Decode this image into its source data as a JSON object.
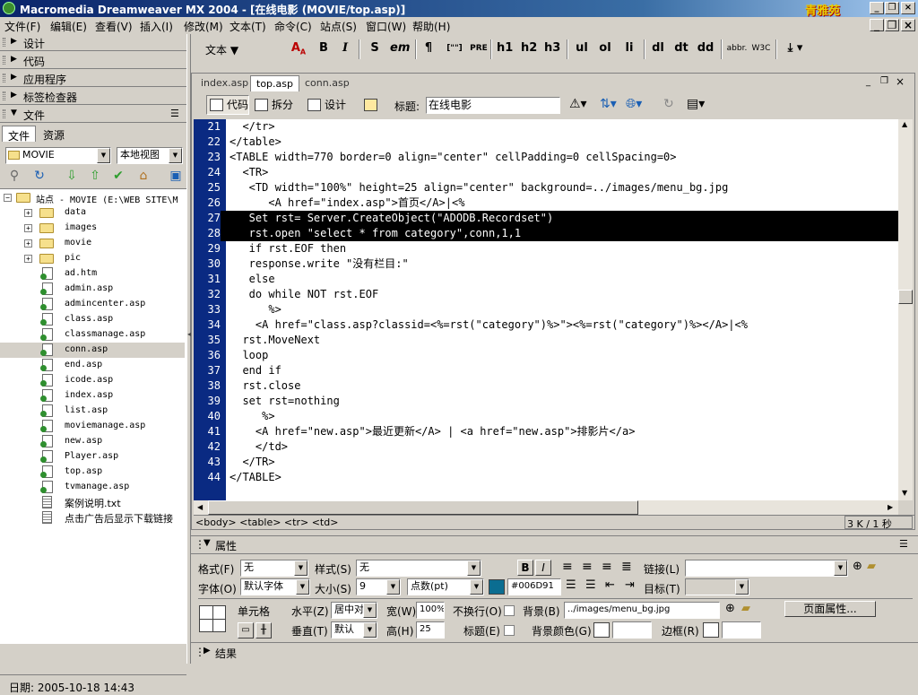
{
  "titlebar": {
    "text": "Macromedia Dreamweaver MX 2004 - [在线电影 (MOVIE/top.asp)]",
    "logo": "青雅苑"
  },
  "menus": [
    "文件(F)",
    "编辑(E)",
    "查看(V)",
    "插入(I)",
    "修改(M)",
    "文本(T)",
    "命令(C)",
    "站点(S)",
    "窗口(W)",
    "帮助(H)"
  ],
  "panels": [
    {
      "label": "设计",
      "collapsed": true
    },
    {
      "label": "代码",
      "collapsed": true
    },
    {
      "label": "应用程序",
      "collapsed": true
    },
    {
      "label": "标签检查器",
      "collapsed": true
    },
    {
      "label": "文件",
      "collapsed": false
    }
  ],
  "files_panel": {
    "tabs": [
      "文件",
      "资源"
    ],
    "site_select": "MOVIE",
    "view_select": "本地视图",
    "root": "站点 - MOVIE (E:\\WEB SITE\\M",
    "items": [
      {
        "name": "data",
        "type": "folder"
      },
      {
        "name": "images",
        "type": "folder"
      },
      {
        "name": "movie",
        "type": "folder"
      },
      {
        "name": "pic",
        "type": "folder"
      },
      {
        "name": "ad.htm",
        "type": "file"
      },
      {
        "name": "admin.asp",
        "type": "file"
      },
      {
        "name": "admincenter.asp",
        "type": "file"
      },
      {
        "name": "class.asp",
        "type": "file"
      },
      {
        "name": "classmanage.asp",
        "type": "file"
      },
      {
        "name": "conn.asp",
        "type": "file",
        "selected": true
      },
      {
        "name": "end.asp",
        "type": "file"
      },
      {
        "name": "icode.asp",
        "type": "file"
      },
      {
        "name": "index.asp",
        "type": "file"
      },
      {
        "name": "list.asp",
        "type": "file"
      },
      {
        "name": "moviemanage.asp",
        "type": "file"
      },
      {
        "name": "new.asp",
        "type": "file"
      },
      {
        "name": "Player.asp",
        "type": "file"
      },
      {
        "name": "top.asp",
        "type": "file"
      },
      {
        "name": "tvmanage.asp",
        "type": "file"
      },
      {
        "name": "案例说明.txt",
        "type": "txt"
      },
      {
        "name": "点击广告后显示下载链接",
        "type": "txt"
      }
    ],
    "date": "日期: 2005-10-18 14:43"
  },
  "insertbar": {
    "category": "文本",
    "buttons": [
      "B",
      "I",
      "S",
      "em",
      "¶",
      "[\"\"]",
      "PRE",
      "h1",
      "h2",
      "h3",
      "ul",
      "ol",
      "li",
      "dl",
      "dt",
      "dd",
      "abbr.",
      "W3C"
    ]
  },
  "document": {
    "tabs": [
      "index.asp",
      "top.asp",
      "conn.asp"
    ],
    "active_tab": "top.asp",
    "view_buttons": {
      "code": "代码",
      "split": "拆分",
      "design": "设计"
    },
    "title_label": "标题:",
    "title_value": "在线电影",
    "status_tags": "<body> <table> <tr> <td>",
    "status_size": "3 K / 1 秒"
  },
  "code_lines": [
    {
      "n": "21",
      "t": "  </tr>"
    },
    {
      "n": "22",
      "t": "</table>"
    },
    {
      "n": "23",
      "t": "<TABLE width=770 border=0 align=\"center\" cellPadding=0 cellSpacing=0>"
    },
    {
      "n": "24",
      "t": "  <TR>"
    },
    {
      "n": "25",
      "t": "   <TD width=\"100%\" height=25 align=\"center\" background=../images/menu_bg.jpg"
    },
    {
      "n": "26",
      "t": "      <A href=\"index.asp\">首页</A>|<%"
    },
    {
      "n": "27",
      "t": "   Set rst= Server.CreateObject(\"ADODB.Recordset\")",
      "hl": true
    },
    {
      "n": "28",
      "t": "   rst.open \"select * from category\",conn,1,1",
      "hl": true
    },
    {
      "n": "29",
      "t": "   if rst.EOF then"
    },
    {
      "n": "30",
      "t": "   response.write \"没有栏目:\""
    },
    {
      "n": "31",
      "t": "   else"
    },
    {
      "n": "32",
      "t": "   do while NOT rst.EOF"
    },
    {
      "n": "33",
      "t": "      %>"
    },
    {
      "n": "34",
      "t": "    <A href=\"class.asp?classid=<%=rst(\"category\")%>\"><%=rst(\"category\")%></A>|<%"
    },
    {
      "n": "35",
      "t": "  rst.MoveNext"
    },
    {
      "n": "36",
      "t": "  loop"
    },
    {
      "n": "37",
      "t": "  end if"
    },
    {
      "n": "38",
      "t": "  rst.close"
    },
    {
      "n": "39",
      "t": "  set rst=nothing"
    },
    {
      "n": "40",
      "t": "     %>"
    },
    {
      "n": "41",
      "t": "    <A href=\"new.asp\">最近更新</A> | <a href=\"new.asp\">排影片</a>"
    },
    {
      "n": "42",
      "t": "    </td>"
    },
    {
      "n": "43",
      "t": "  </TR>"
    },
    {
      "n": "44",
      "t": "</TABLE>"
    }
  ],
  "properties": {
    "header": "属性",
    "format_label": "格式(F)",
    "format_value": "无",
    "style_label": "样式(S)",
    "style_value": "无",
    "font_label": "字体(O)",
    "font_value": "默认字体",
    "size_label": "大小(S)",
    "size_value": "9",
    "unit_value": "点数(pt)",
    "color_hex": "#006D91",
    "color_swatch": "#0b6d91",
    "link_label": "链接(L)",
    "target_label": "目标(T)",
    "cell_label": "单元格",
    "horz_label": "水平(Z)",
    "horz_value": "居中对",
    "vert_label": "垂直(T)",
    "vert_value": "默认",
    "width_label": "宽(W)",
    "width_value": "100%",
    "height_label": "高(H)",
    "height_value": "25",
    "nowrap_label": "不换行(O)",
    "header_label": "标题(E)",
    "bg_label": "背景(B)",
    "bg_value": "../images/menu_bg.jpg",
    "bgcolor_label": "背景颜色(G)",
    "border_label": "边框(R)",
    "page_props": "页面属性..."
  },
  "results_label": "结果"
}
